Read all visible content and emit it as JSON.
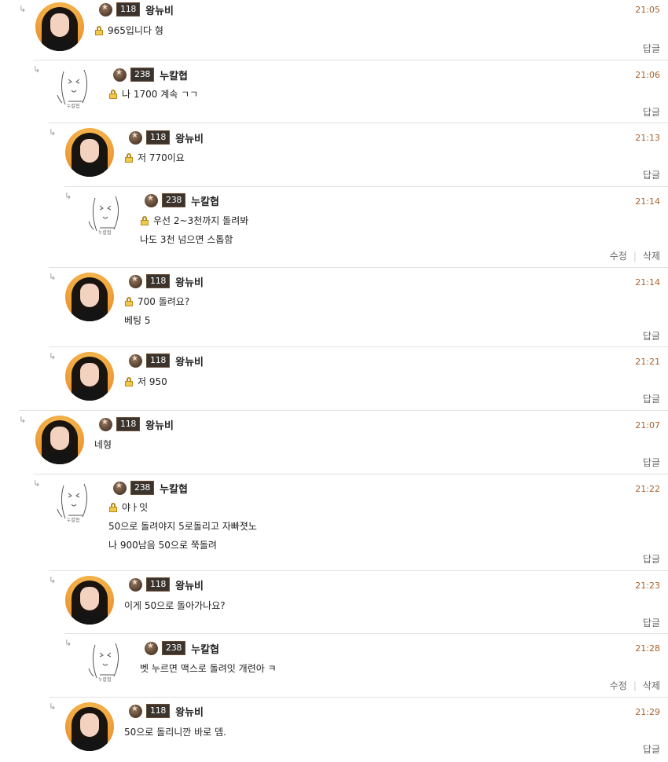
{
  "comments": [
    {
      "user": "왕뉴비",
      "level": "118",
      "time": "21:05",
      "lines": [
        "965입니다 형"
      ],
      "lock": true,
      "avatar": "photo-avatar",
      "actions": [
        "답글"
      ]
    },
    {
      "user": "누칼협",
      "level": "238",
      "time": "21:06",
      "lines": [
        "나 1700 계속 ㄱㄱ"
      ],
      "lock": true,
      "avatar": "sketch-avatar",
      "actions": [
        "답글"
      ]
    },
    {
      "user": "왕뉴비",
      "level": "118",
      "time": "21:13",
      "lines": [
        "저 770이요"
      ],
      "lock": true,
      "avatar": "photo-avatar",
      "actions": [
        "답글"
      ]
    },
    {
      "user": "누칼협",
      "level": "238",
      "time": "21:14",
      "lines": [
        "우선 2~3천까지 돌려봐",
        "나도 3천 넘으면 스톱함"
      ],
      "lock": true,
      "avatar": "sketch-avatar",
      "actions": [
        "수정",
        "삭제"
      ]
    },
    {
      "user": "왕뉴비",
      "level": "118",
      "time": "21:14",
      "lines": [
        "700 돌려요?",
        "베팅 5"
      ],
      "lock": true,
      "avatar": "photo-avatar",
      "actions": [
        "답글"
      ]
    },
    {
      "user": "왕뉴비",
      "level": "118",
      "time": "21:21",
      "lines": [
        "저 950"
      ],
      "lock": true,
      "avatar": "photo-avatar",
      "actions": [
        "답글"
      ]
    },
    {
      "user": "왕뉴비",
      "level": "118",
      "time": "21:07",
      "lines": [
        "네형"
      ],
      "lock": false,
      "avatar": "photo-avatar",
      "actions": [
        "답글"
      ]
    },
    {
      "user": "누칼협",
      "level": "238",
      "time": "21:22",
      "lines": [
        "야ㅏ잇",
        "50으로 돌려야지 5로돌리고 자빠졋노",
        "나 900남음 50으로 쭉돌려"
      ],
      "lock": true,
      "avatar": "sketch-avatar",
      "actions": [
        "답글"
      ]
    },
    {
      "user": "왕뉴비",
      "level": "118",
      "time": "21:23",
      "lines": [
        "이게 50으로 돌아가나요?"
      ],
      "lock": false,
      "avatar": "photo-avatar",
      "actions": [
        "답글"
      ]
    },
    {
      "user": "누칼협",
      "level": "238",
      "time": "21:28",
      "lines": [
        "벳 누르면 맥스로 돌려잇 개련아 ㅋ"
      ],
      "lock": false,
      "avatar": "sketch-avatar",
      "actions": [
        "수정",
        "삭제"
      ]
    },
    {
      "user": "왕뉴비",
      "level": "118",
      "time": "21:29",
      "lines": [
        "50으로 돌리니깐 바로 뎀."
      ],
      "lock": false,
      "avatar": "photo-avatar",
      "actions": [
        "답글"
      ]
    }
  ],
  "reply_arrow": "↳"
}
